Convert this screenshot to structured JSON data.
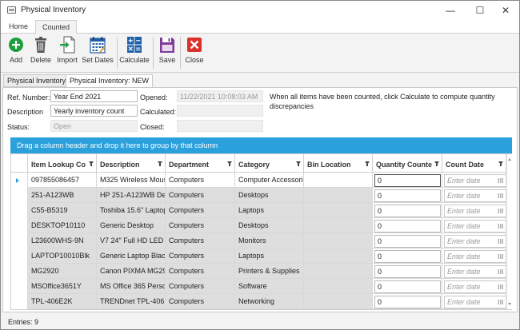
{
  "window": {
    "title": "Physical Inventory"
  },
  "menu_tabs": [
    {
      "label": "Home"
    },
    {
      "label": "Counted"
    }
  ],
  "ribbon": {
    "add": "Add",
    "delete": "Delete",
    "import": "Import",
    "set_dates": "Set Dates",
    "calculate": "Calculate",
    "save": "Save",
    "close": "Close"
  },
  "doc_tabs": [
    {
      "label": "Physical Inventory"
    },
    {
      "label": "Physical Inventory: NEW"
    }
  ],
  "form": {
    "ref_label": "Ref. Number:",
    "ref_value": "Year End 2021",
    "desc_label": "Description",
    "desc_value": "Yearly inventory count",
    "status_label": "Status:",
    "status_value": "Open",
    "opened_label": "Opened:",
    "opened_value": "11/22/2021 10:08:03 AM",
    "calculated_label": "Calculated:",
    "calculated_value": "",
    "closed_label": "Closed:",
    "closed_value": ""
  },
  "info_text": "When all items have been counted, click Calculate to compute quantity discrepancies",
  "grid": {
    "group_hint": "Drag a column header and drop it here to group by that column",
    "columns": [
      "Item Lookup Co",
      "Description",
      "Department",
      "Category",
      "Bin Location",
      "Quantity Counte",
      "Count Date"
    ],
    "date_placeholder": "Enter date",
    "rows": [
      {
        "code": "097855086457",
        "desc": "M325 Wireless Mous",
        "dept": "Computers",
        "cat": "Computer Accessorie",
        "bin": "",
        "qty": "0"
      },
      {
        "code": "251-A123WB",
        "desc": "HP 251-A123WB Des",
        "dept": "Computers",
        "cat": "Desktops",
        "bin": "",
        "qty": "0"
      },
      {
        "code": "C55-B5319",
        "desc": "Toshiba 15.6\" Laptop",
        "dept": "Computers",
        "cat": "Laptops",
        "bin": "",
        "qty": "0"
      },
      {
        "code": "DESKTOP10110",
        "desc": "Generic Desktop",
        "dept": "Computers",
        "cat": "Desktops",
        "bin": "",
        "qty": "0"
      },
      {
        "code": "L23600WHS-9N",
        "desc": "V7 24\" Full HD LED M",
        "dept": "Computers",
        "cat": "Monitors",
        "bin": "",
        "qty": "0"
      },
      {
        "code": "LAPTOP10010Blk",
        "desc": "Generic Laptop Black",
        "dept": "Computers",
        "cat": "Laptops",
        "bin": "",
        "qty": "0"
      },
      {
        "code": "MG2920",
        "desc": "Canon PIXMA MG292",
        "dept": "Computers",
        "cat": "Printers & Supplies",
        "bin": "",
        "qty": "0"
      },
      {
        "code": "MSOffice3651Y",
        "desc": "MS Office 365 Persor",
        "dept": "Computers",
        "cat": "Software",
        "bin": "",
        "qty": "0"
      },
      {
        "code": "TPL-406E2K",
        "desc": "TRENDnet TPL-406E2",
        "dept": "Computers",
        "cat": "Networking",
        "bin": "",
        "qty": "0"
      }
    ]
  },
  "status": {
    "entries_label": "Entries:",
    "entries_value": "9"
  },
  "colors": {
    "accent": "#2aa0dc",
    "add": "#1e9e3e",
    "delete": "#555555",
    "save": "#7d3c98",
    "close": "#d9322a",
    "calc": "#1f5fa8"
  }
}
